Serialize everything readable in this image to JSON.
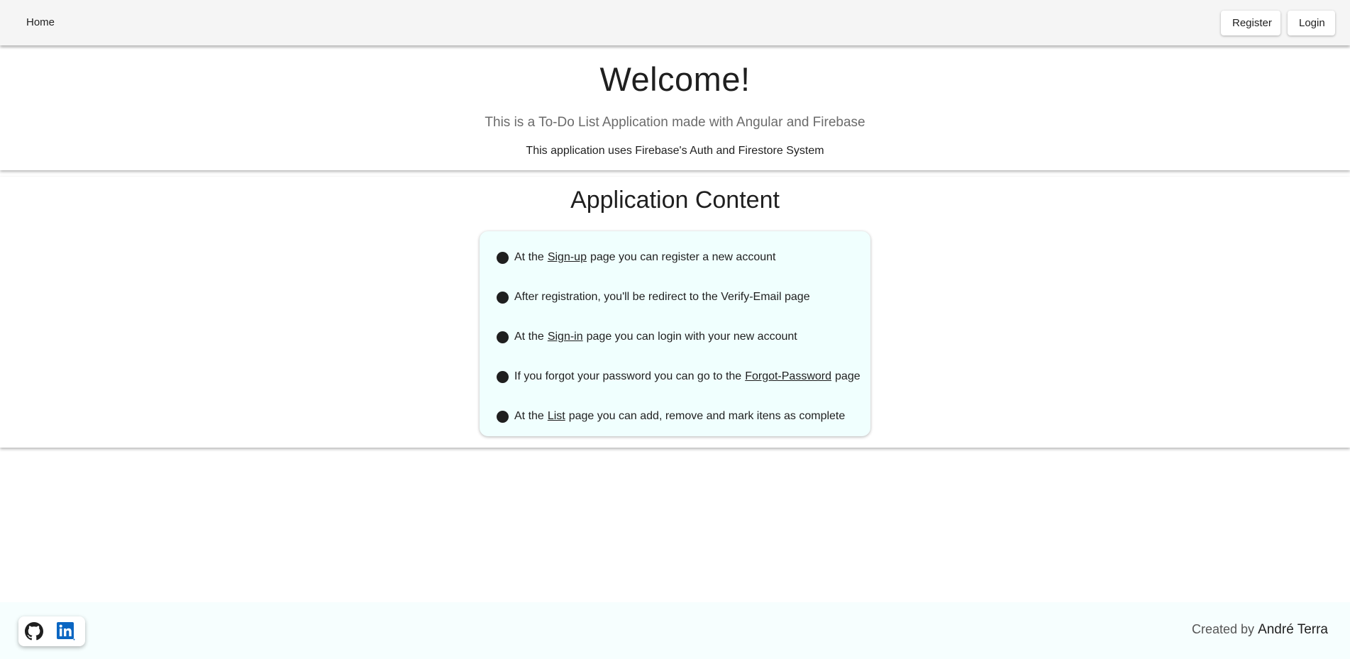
{
  "navbar": {
    "home_label": "Home",
    "register_label": "Register",
    "login_label": "Login"
  },
  "welcome": {
    "title": "Welcome!",
    "subtitle_prefix": "This is a To-Do List Application made with",
    "angular_link": "Angular",
    "subtitle_and": "and",
    "firebase_link": "Firebase",
    "note": "This application uses Firebase's Auth and Firestore System"
  },
  "content": {
    "title": "Application Content",
    "items": [
      {
        "before": "At the",
        "link": "Sign-up",
        "after": "page you can register a new account"
      },
      {
        "text": "After registration, you'll be redirect to the Verify-Email page"
      },
      {
        "before": "At the",
        "link": "Sign-in",
        "after": "page you can login with your new account"
      },
      {
        "before": "If you forgot your password you can go to the",
        "link": "Forgot-Password",
        "after": "page"
      },
      {
        "before": "At the",
        "link": "List",
        "after": "page you can add, remove and mark itens as complete"
      }
    ]
  },
  "footer": {
    "created_by": "Created by",
    "author": "André Terra",
    "icons": [
      "github-icon",
      "linkedin-icon"
    ]
  },
  "colors": {
    "navbar_bg": "#f5f5f5",
    "panel_bg": "#f0fffe",
    "footer_bg": "#f6fefe",
    "linkedin_blue": "#0a66c2"
  }
}
